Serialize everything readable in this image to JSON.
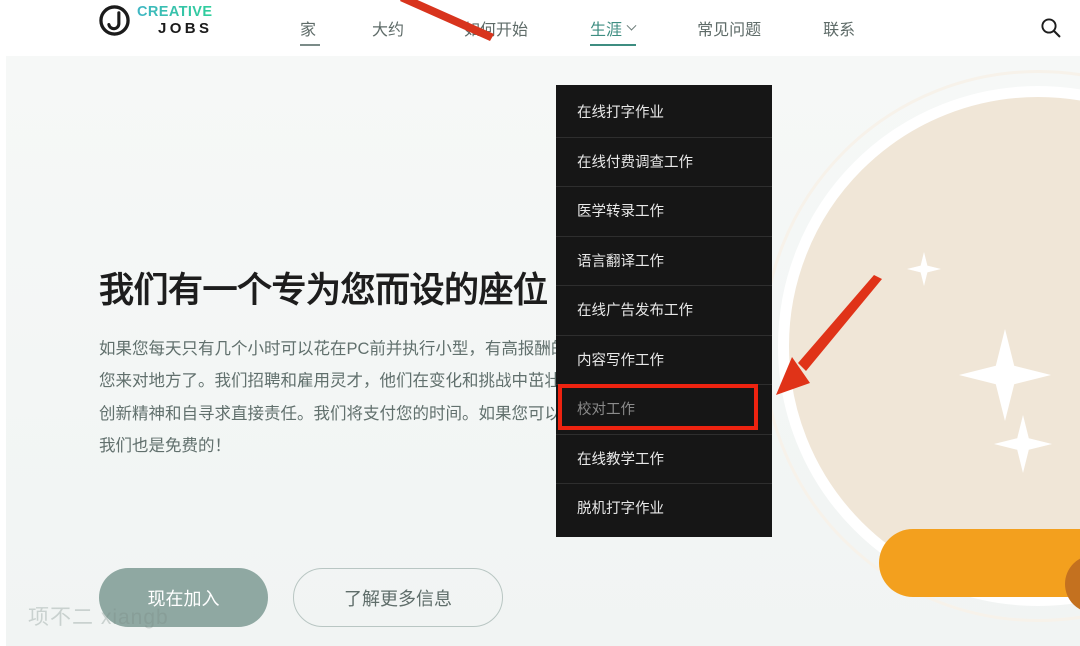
{
  "brand": {
    "name_line1": "CREATIVE",
    "name_line2": "JOBS",
    "logo_icon": "circle-cj-logo-icon",
    "accent_teal": "#35c3a8",
    "accent_dark": "#1b1b1b"
  },
  "header": {
    "nav": [
      {
        "label": "家",
        "active": false,
        "has_underline": true,
        "has_chevron": false
      },
      {
        "label": "大约",
        "active": false,
        "has_underline": false,
        "has_chevron": false
      },
      {
        "label": "如何开始",
        "active": false,
        "has_underline": false,
        "has_chevron": false
      },
      {
        "label": "生涯",
        "active": true,
        "has_underline": true,
        "has_chevron": true
      },
      {
        "label": "常见问题",
        "active": false,
        "has_underline": false,
        "has_chevron": false
      },
      {
        "label": "联系",
        "active": false,
        "has_underline": false,
        "has_chevron": false
      }
    ],
    "search_icon": "search-icon"
  },
  "dropdown": {
    "open_for": "生涯",
    "background": "#161616",
    "items": [
      {
        "label": "在线打字作业",
        "highlighted": false
      },
      {
        "label": "在线付费调查工作",
        "highlighted": false
      },
      {
        "label": "医学转录工作",
        "highlighted": false
      },
      {
        "label": "语言翻译工作",
        "highlighted": false
      },
      {
        "label": "在线广告发布工作",
        "highlighted": false
      },
      {
        "label": "内容写作工作",
        "highlighted": false
      },
      {
        "label": "校对工作",
        "highlighted": true
      },
      {
        "label": "在线教学工作",
        "highlighted": false
      },
      {
        "label": "脱机打字作业",
        "highlighted": false
      }
    ]
  },
  "hero": {
    "title": "我们有一个专为您而设的座位",
    "paragraph": "如果您每天只有几个小时可以花在PC前并执行小型，有高报酬的任务，那么您来对地方了。我们招聘和雇用灵才，他们在变化和挑战中茁壮成长，具有创新精神和自寻求直接责任。我们将支付您的时间。如果您可以免费是的，我们也是免费的！",
    "primary_button": "现在加入",
    "secondary_button": "了解更多信息"
  },
  "watermark": {
    "text": "项不二 xiangb"
  },
  "annotations": {
    "highlight_color": "#ee2310",
    "arrow_color": "#e03318",
    "arrow_main_target": "校对工作",
    "arrow_count": 2
  },
  "illustration": {
    "circle_color": "#f0e6d7",
    "ring_color": "#ffffff",
    "sleeve_color": "#f3a01e",
    "cuff_color": "#c4711f",
    "navy_color": "#262a4a",
    "sparkle_color": "#ffffff"
  }
}
